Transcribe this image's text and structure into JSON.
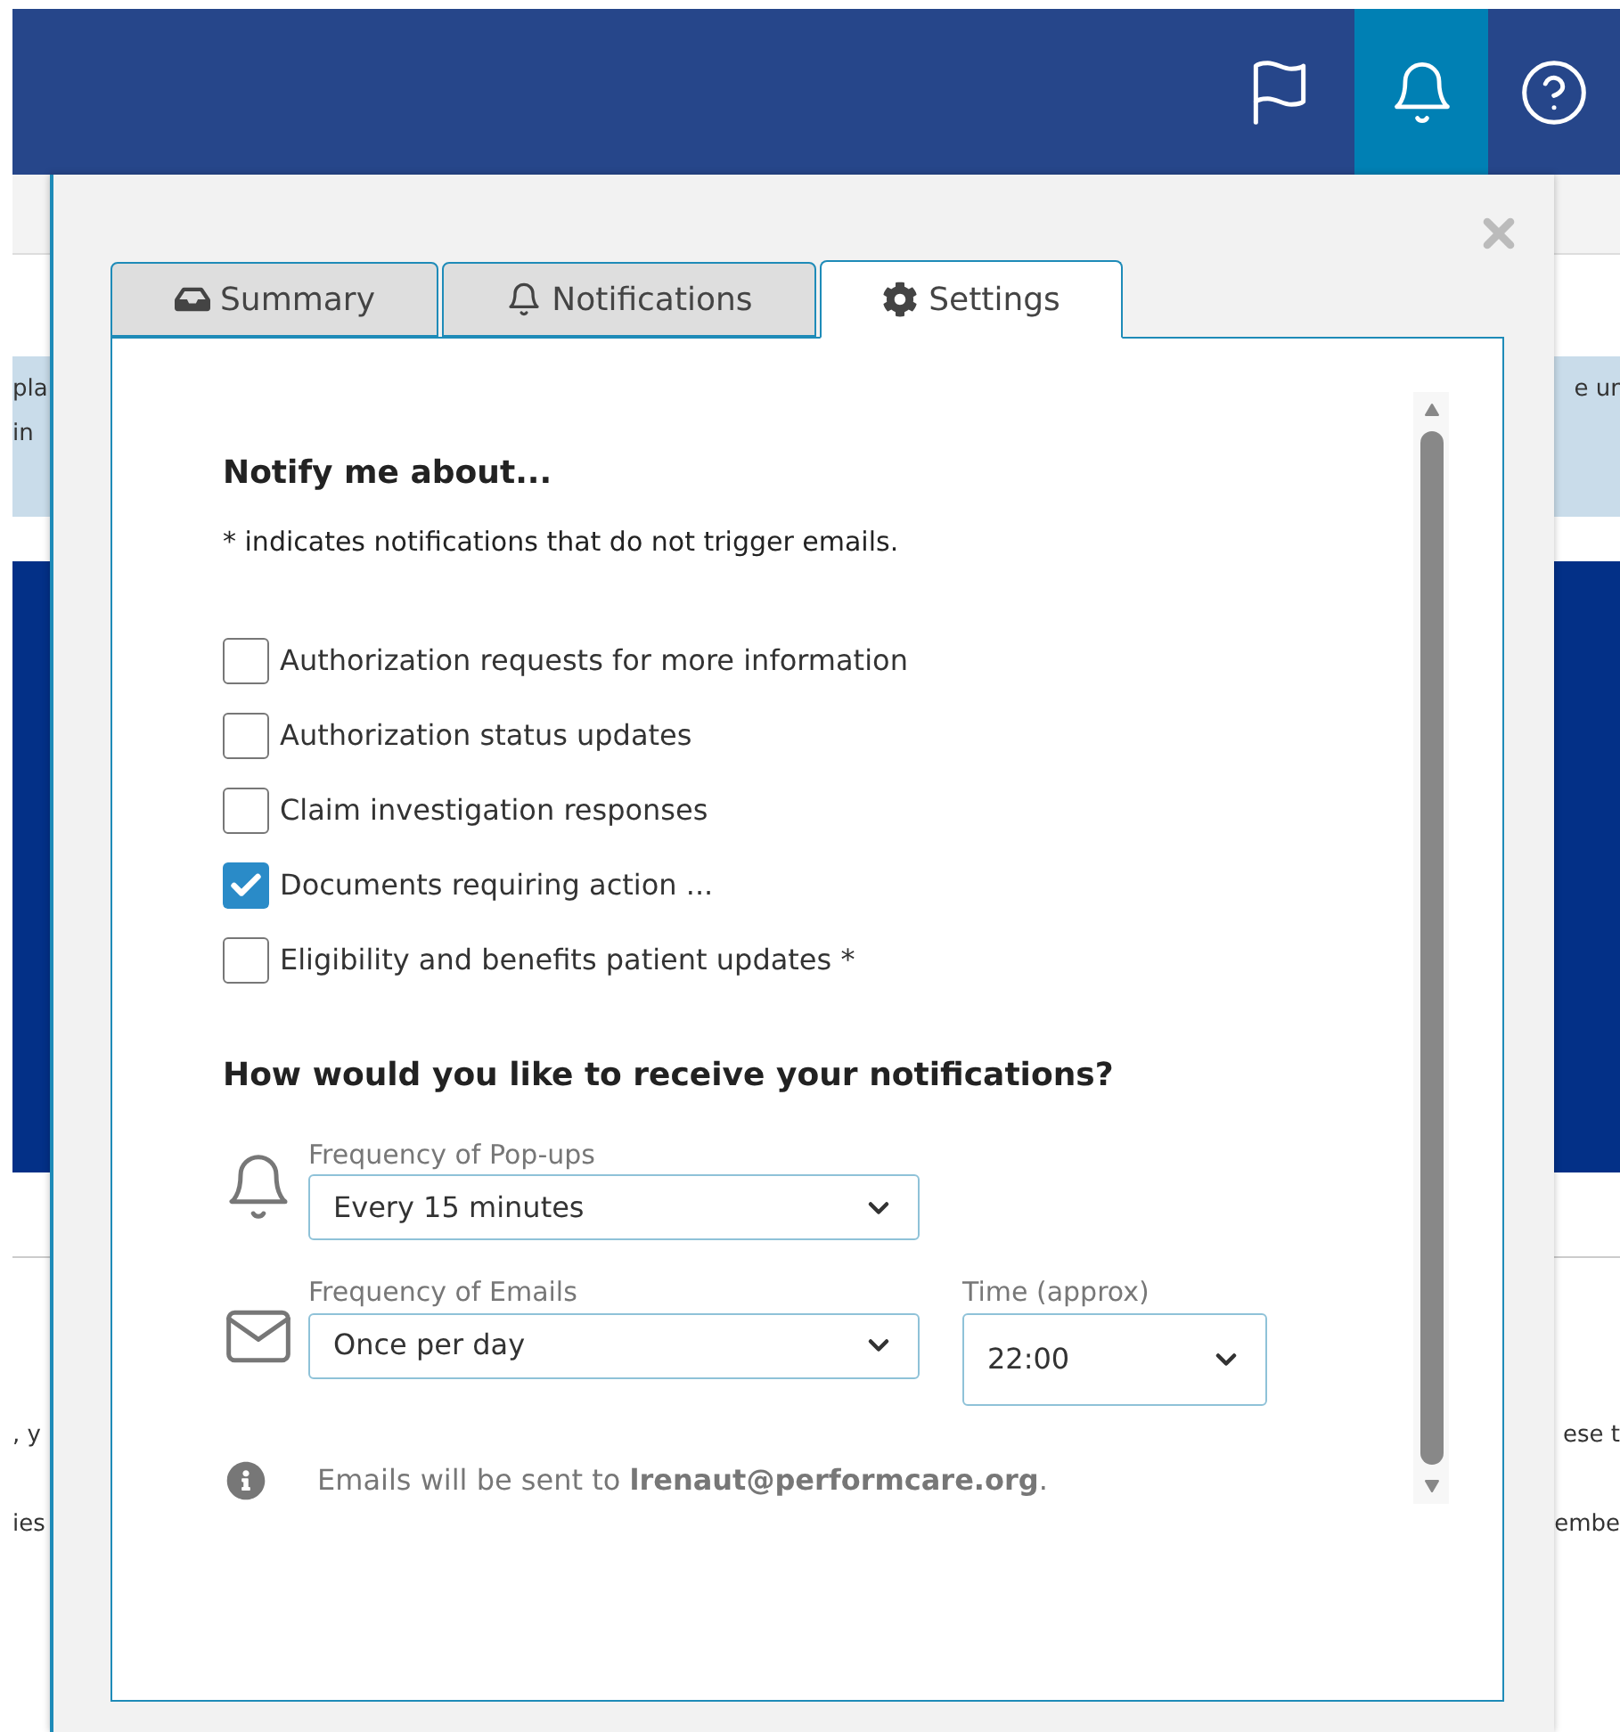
{
  "background": {
    "left_fragments": [
      "pla",
      "in",
      ", y",
      "ies"
    ],
    "right_fragments": [
      "e ur",
      "ese t",
      "embe"
    ]
  },
  "dialog": {
    "tabs": [
      {
        "label": "Summary",
        "selected": false
      },
      {
        "label": "Notifications",
        "selected": false
      },
      {
        "label": "Settings",
        "selected": true
      }
    ],
    "heading": "Notify me about...",
    "note": "* indicates notifications that do not trigger emails.",
    "options": [
      {
        "label": "Authorization requests for more information",
        "checked": false
      },
      {
        "label": "Authorization status updates",
        "checked": false
      },
      {
        "label": "Claim investigation responses",
        "checked": false
      },
      {
        "label": "Documents requiring action ...",
        "checked": true
      },
      {
        "label": "Eligibility and benefits patient updates *",
        "checked": false
      }
    ],
    "delivery_heading": "How would you like to receive your notifications?",
    "popup_frequency": {
      "label": "Frequency of Pop-ups",
      "value": "Every 15 minutes"
    },
    "email_frequency": {
      "label": "Frequency of Emails",
      "value": "Once per day"
    },
    "time": {
      "label": "Time (approx)",
      "value": "22:00"
    },
    "email_note": "Emails will be sent to **lrenaut@performcare.org**."
  }
}
